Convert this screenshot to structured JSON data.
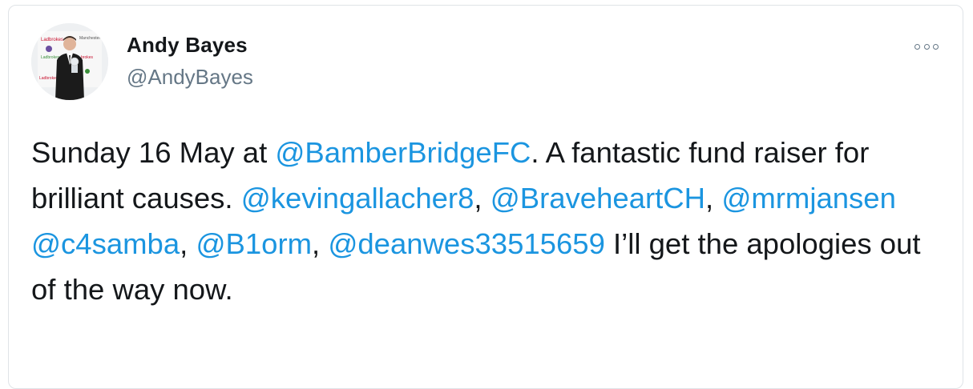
{
  "author": {
    "name": "Andy Bayes",
    "handle": "@AndyBayes",
    "avatar_icon": "profile-photo-icon"
  },
  "menu": {
    "icon": "more-options-icon"
  },
  "tweet": {
    "segments": [
      {
        "text": "Sunday 16 May at ",
        "mention": false
      },
      {
        "text": "@BamberBridgeFC",
        "mention": true
      },
      {
        "text": ". A fantastic fund raiser for brilliant causes. ",
        "mention": false
      },
      {
        "text": "@kevingallacher8",
        "mention": true
      },
      {
        "text": ", ",
        "mention": false
      },
      {
        "text": "@BraveheartCH",
        "mention": true
      },
      {
        "text": ", ",
        "mention": false
      },
      {
        "text": "@mrmjansen",
        "mention": true
      },
      {
        "text": " ",
        "mention": false
      },
      {
        "text": "@c4samba",
        "mention": true
      },
      {
        "text": ", ",
        "mention": false
      },
      {
        "text": "@B1orm",
        "mention": true
      },
      {
        "text": ", ",
        "mention": false
      },
      {
        "text": "@deanwes33515659",
        "mention": true
      },
      {
        "text": " I’ll get the apologies out of the way now.",
        "mention": false
      }
    ]
  },
  "colors": {
    "mention": "#1b95e0",
    "text": "#14171a",
    "secondary": "#657786",
    "border": "#dfe3e7"
  }
}
